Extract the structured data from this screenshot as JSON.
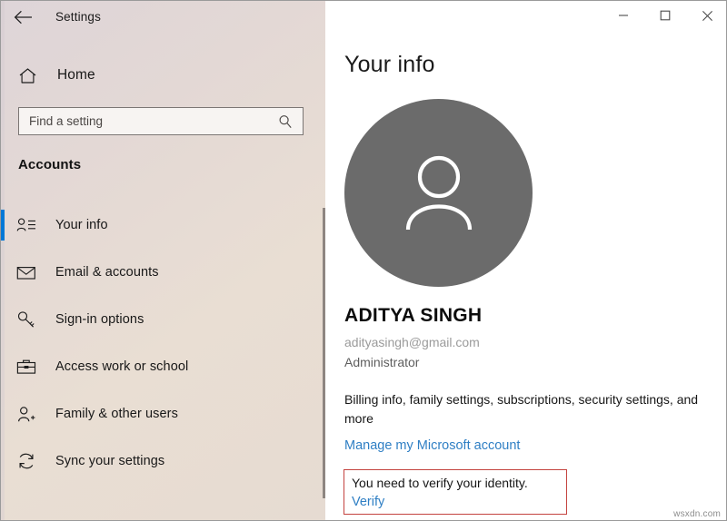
{
  "window": {
    "app_title": "Settings",
    "back_icon": "back-arrow-icon",
    "controls": {
      "minimize": "minimize-icon",
      "maximize": "maximize-icon",
      "close": "close-icon"
    }
  },
  "sidebar": {
    "home_label": "Home",
    "home_icon": "home-icon",
    "search": {
      "placeholder": "Find a setting",
      "value": "",
      "icon": "search-icon"
    },
    "section_title": "Accounts",
    "items": [
      {
        "label": "Your info",
        "icon": "user-info-icon",
        "selected": true
      },
      {
        "label": "Email & accounts",
        "icon": "envelope-icon",
        "selected": false
      },
      {
        "label": "Sign-in options",
        "icon": "key-icon",
        "selected": false
      },
      {
        "label": "Access work or school",
        "icon": "briefcase-icon",
        "selected": false
      },
      {
        "label": "Family & other users",
        "icon": "user-add-icon",
        "selected": false
      },
      {
        "label": "Sync your settings",
        "icon": "sync-icon",
        "selected": false
      }
    ]
  },
  "main": {
    "page_title": "Your info",
    "avatar_icon": "user-avatar-icon",
    "user_name": "ADITYA SINGH",
    "user_email": "adityasingh@gmail.com",
    "user_role": "Administrator",
    "billing_text": "Billing info, family settings, subscriptions, security settings, and more",
    "manage_link": "Manage my Microsoft account",
    "verify": {
      "message": "You need to verify your identity.",
      "link": "Verify"
    }
  },
  "watermark": "wsxdn.com",
  "colors": {
    "accent_blue": "#0078d7",
    "link_blue": "#2f7fc4",
    "alert_red": "#c4433f",
    "avatar_gray": "#6b6b6b"
  }
}
